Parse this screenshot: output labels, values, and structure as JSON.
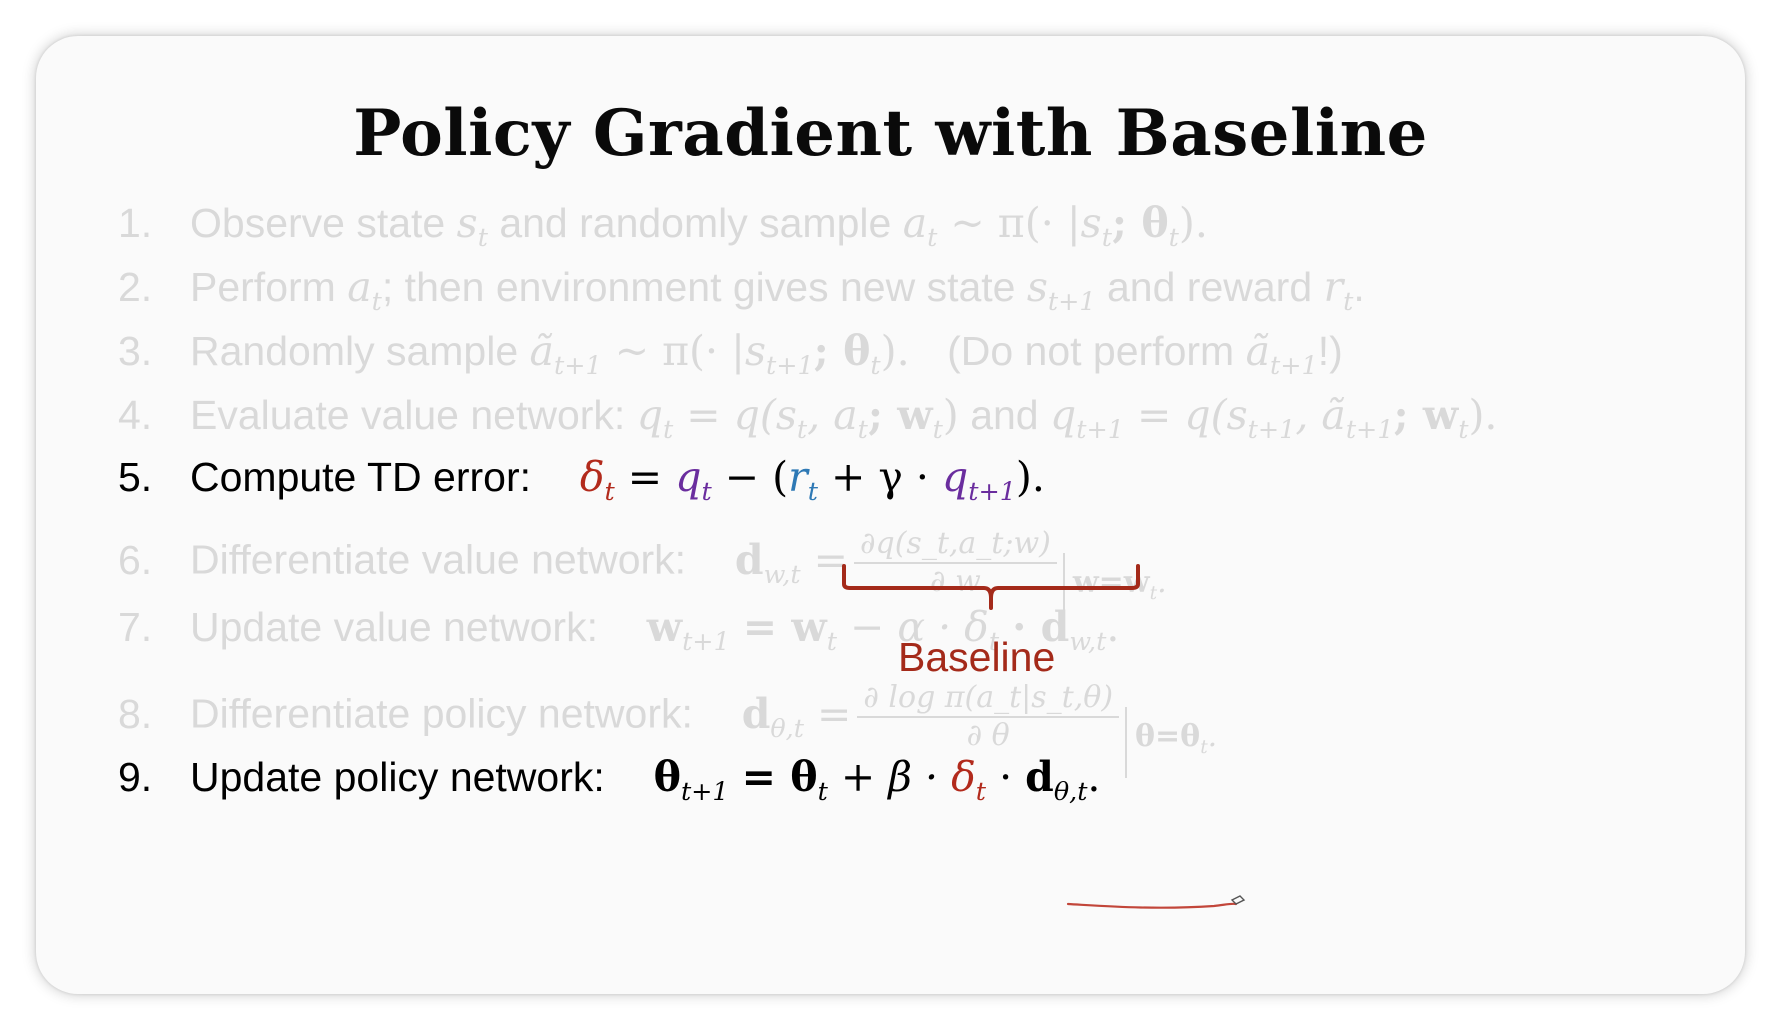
{
  "slide": {
    "title": "Policy Gradient with Baseline",
    "steps": [
      {
        "number": "1.",
        "text": "Observe state",
        "math": "s",
        "msub": "t",
        "text2": "and randomly sample",
        "math2": "a",
        "msub2": "t",
        "math3": "~ π(· |",
        "math4": "s",
        "msub4": "t",
        "math5": "; θ",
        "msub5": "t",
        "math6": ")."
      },
      {
        "number": "2.",
        "text": "Perform",
        "math": "a",
        "msub": "t",
        "text2": "; then environment gives new state",
        "math2": "s",
        "msub2": "t+1",
        "text3": "and reward",
        "math3": "r",
        "msub3": "t",
        "tail": "."
      },
      {
        "number": "3.",
        "text": "Randomly sample",
        "math": "ã",
        "msub": "t+1",
        "math2": "~ π(· |",
        "math3": "s",
        "msub3": "t+1",
        "math4": "; θ",
        "msub4": "t",
        "math5": ").",
        "text2": "(Do not perform",
        "math6": "ã",
        "msub6": "t+1",
        "text3": "!)"
      },
      {
        "number": "4.",
        "text": "Evaluate value network:",
        "math": "q",
        "msub": "t",
        "math2": "= q(s",
        "msub2": "t",
        "math3": ", a",
        "msub3": "t",
        "math4": "; w",
        "msub4": "t",
        "math5": ")",
        "text2": "and",
        "math6": "q",
        "msub6": "t+1",
        "math7": "= q(s",
        "msub7": "t+1",
        "math8": ", ã",
        "msub8": "t+1",
        "math9": "; w",
        "msub9": "t",
        "math10": ")."
      },
      {
        "number": "5.",
        "text": "Compute TD error:",
        "delta": "δ",
        "delta_sub": "t",
        "eq": "=",
        "q": "q",
        "q_sub": "t",
        "minus": "− (",
        "r": "r",
        "r_sub": "t",
        "plus": "+ γ ·",
        "q2": "q",
        "q2_sub": "t+1",
        "close": ")."
      },
      {
        "number": "6.",
        "text": "Differentiate value network:",
        "lhs": "d",
        "lhs_sub": "w,t",
        "eq": "=",
        "numer": "∂q(s_t,a_t;w)",
        "denom": "∂ w",
        "eval": "w=w",
        "eval_sub": "t",
        "tail": "."
      },
      {
        "number": "7.",
        "text": "Update value network:",
        "lhs": "w",
        "lhs_sub": "t+1",
        "eq": "= w",
        "eq_sub": "t",
        "rest": "− α · δ",
        "rest_sub": "t",
        "rest2": "· d",
        "rest2_sub": "w,t",
        "tail": "."
      },
      {
        "number": "8.",
        "text": "Differentiate policy network:",
        "lhs": "d",
        "lhs_sub": "θ,t",
        "eq": "=",
        "numer": "∂ log π(a_t|s_t,θ)",
        "denom": "∂ θ",
        "eval": "θ=θ",
        "eval_sub": "t",
        "tail": "."
      },
      {
        "number": "9.",
        "text": "Update policy network:",
        "lhs": "θ",
        "lhs_sub": "t+1",
        "eq": "= θ",
        "eq_sub": "t",
        "plus": "+ β ·",
        "delta": "δ",
        "delta_sub": "t",
        "dot": "·",
        "d": "d",
        "d_sub": "θ,t",
        "tail": "."
      }
    ],
    "brace_label": "Baseline"
  },
  "colors": {
    "title": "#0a0a0a",
    "dim_text": "#d9d9d9",
    "delta": "#b22a1c",
    "q": "#6a2d9e",
    "r": "#2e79b5",
    "baseline": "#a42a1a"
  }
}
